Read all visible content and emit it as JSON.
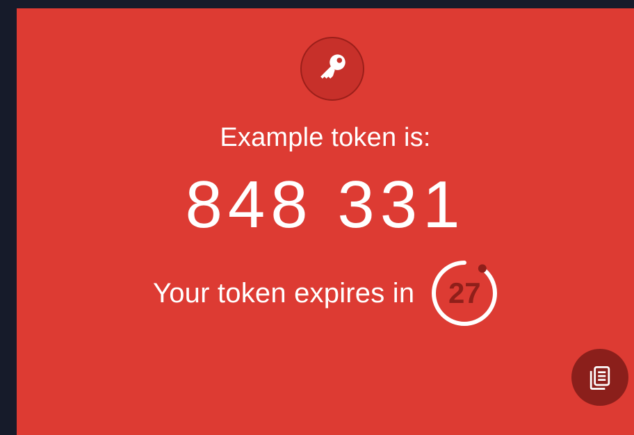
{
  "colors": {
    "background": "#161b2a",
    "card": "#dd3b33",
    "key_badge": "#c7302a",
    "timer_text": "#8f1f1a",
    "copy_button": "#8b1f1b",
    "text": "#ffffff"
  },
  "header": {
    "icon": "key-icon"
  },
  "token": {
    "label": "Example token is:",
    "code": "848 331"
  },
  "expiry": {
    "text": "Your token expires in",
    "seconds_remaining": "27",
    "progress_fraction": 0.9
  },
  "actions": {
    "copy_icon": "copy-icon"
  }
}
